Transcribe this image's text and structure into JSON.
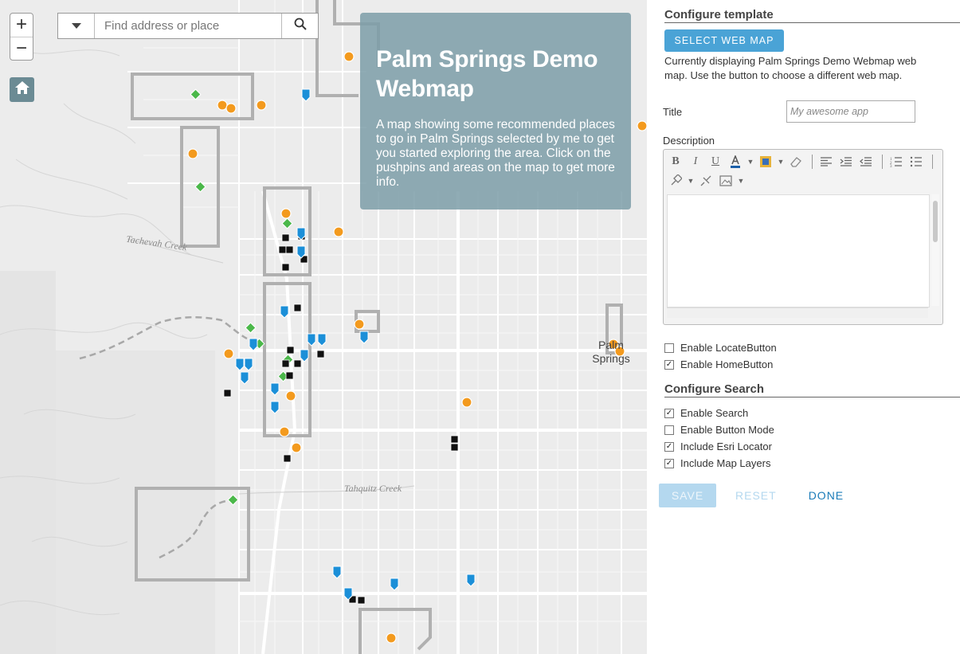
{
  "map": {
    "zoom_in": "+",
    "zoom_out": "−",
    "search_placeholder": "Find address or place",
    "info_title": "Palm Springs Demo Webmap",
    "info_description": "A map showing some recommended places to go in Palm Springs selected by me to get you started exploring the area. Click on the pushpins and areas on the map to get more info.",
    "labels": {
      "tachevah": "Tachevah Creek",
      "tahquitz": "Tahquitz Creek",
      "palm_springs": "Palm Springs"
    },
    "icons": {
      "home": "home-icon",
      "search": "search-icon",
      "dropdown": "chevron-down-icon"
    },
    "colors": {
      "orange_marker": "#f39a1e",
      "green_marker": "#4bb84a",
      "blue_marker": "#1b8fd8",
      "black_marker": "#111111",
      "area_outline": "#b4b4b4"
    }
  },
  "panel": {
    "configure_template": "Configure template",
    "select_web_map": "SELECT WEB MAP",
    "current_map_text": "Currently displaying Palm Springs Demo Webmap web map. Use the button to choose a different web map.",
    "title_label": "Title",
    "title_placeholder": "My awesome app",
    "description_label": "Description",
    "checks1": [
      {
        "label": "Enable LocateButton",
        "checked": false
      },
      {
        "label": "Enable HomeButton",
        "checked": true
      }
    ],
    "configure_search": "Configure Search",
    "checks2": [
      {
        "label": "Enable Search",
        "checked": true
      },
      {
        "label": "Enable Button Mode",
        "checked": false
      },
      {
        "label": "Include Esri Locator",
        "checked": true
      },
      {
        "label": "Include Map Layers",
        "checked": true
      }
    ],
    "save": "SAVE",
    "reset": "RESET",
    "done": "DONE"
  }
}
